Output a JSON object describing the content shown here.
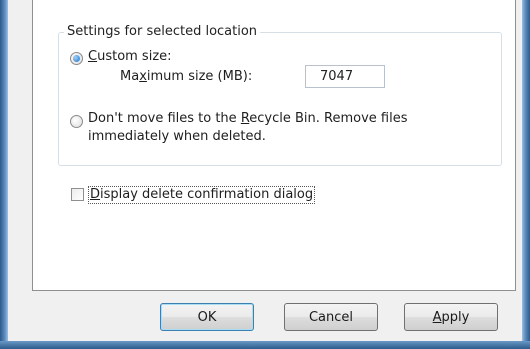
{
  "group": {
    "title": "Settings for selected location"
  },
  "custom_size": {
    "acc": "C",
    "rest": "ustom size:",
    "checked": true
  },
  "max_size": {
    "pre": "Ma",
    "acc": "x",
    "post": "imum size (MB):",
    "value": "7047"
  },
  "dont_move": {
    "pre": "Don't move files to the ",
    "acc": "R",
    "post": "ecycle Bin. Remove files",
    "line2": "immediately when deleted.",
    "checked": false
  },
  "confirm": {
    "acc": "D",
    "rest": "isplay delete confirmation dialog",
    "checked": false
  },
  "buttons": {
    "ok": "OK",
    "cancel": "Cancel",
    "apply_acc": "A",
    "apply_rest": "pply"
  },
  "colors": {
    "frame": "#3c6c9e",
    "dialog_bg": "#f0f0f0",
    "radio_checked": "#1d6fc2"
  }
}
